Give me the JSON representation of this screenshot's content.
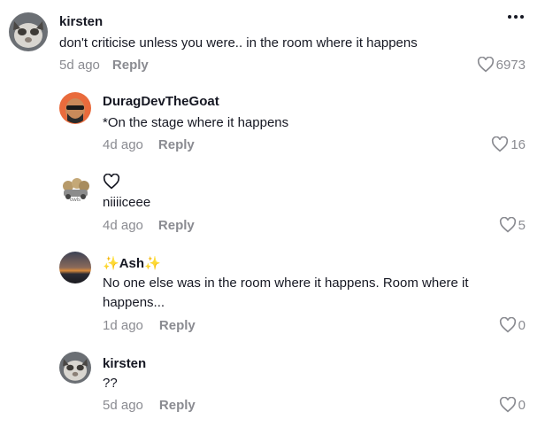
{
  "comments": [
    {
      "username": "kirsten",
      "text": "don't criticise unless you were.. in the room where it happens",
      "age": "5d ago",
      "reply_label": "Reply",
      "likes": "6973",
      "avatar": "cat-photo"
    },
    {
      "username": "DuragDevTheGoat",
      "text": "*On the stage where it happens",
      "age": "4d ago",
      "reply_label": "Reply",
      "likes": "16",
      "avatar": "cartoon-man-with-sunglasses"
    },
    {
      "username": "",
      "text": "niiiiceee",
      "age": "4d ago",
      "reply_label": "Reply",
      "likes": "5",
      "avatar": "cartoon-animals",
      "avatar_caption": "owls"
    },
    {
      "username": "Ash",
      "text_line1": "No one else was in the room where it happens. Room where it",
      "text_line2": "happens...",
      "age": "1d ago",
      "reply_label": "Reply",
      "likes": "0",
      "avatar": "sunset-photo"
    },
    {
      "username": "kirsten",
      "text": "??",
      "age": "5d ago",
      "reply_label": "Reply",
      "likes": "0",
      "avatar": "cat-photo"
    }
  ],
  "colors": {
    "text": "#161823",
    "muted": "#8a8b91",
    "sparkle": "#f0c419"
  }
}
